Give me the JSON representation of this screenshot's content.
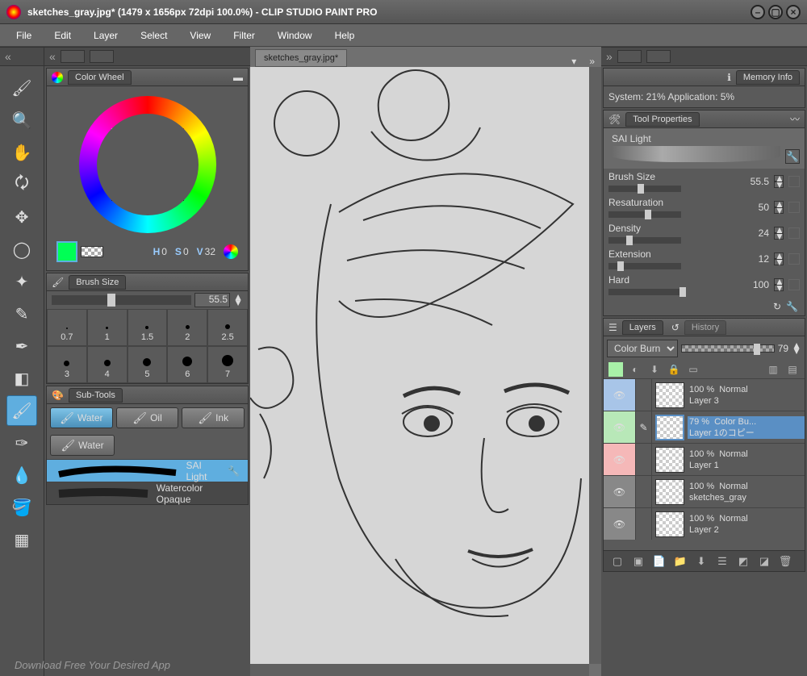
{
  "titlebar": {
    "text": "sketches_gray.jpg* (1479 x 1656px 72dpi 100.0%)  - CLIP STUDIO PAINT PRO"
  },
  "menu": [
    "File",
    "Edit",
    "Layer",
    "Select",
    "View",
    "Filter",
    "Window",
    "Help"
  ],
  "tools": [
    {
      "n": "brush-tool",
      "g": "🖌"
    },
    {
      "n": "zoom-tool",
      "g": "🔍"
    },
    {
      "n": "hand-tool",
      "g": "✋"
    },
    {
      "n": "rotate-tool",
      "g": "🗘"
    },
    {
      "n": "move-tool",
      "g": "✥"
    },
    {
      "n": "lasso-tool",
      "g": "◯"
    },
    {
      "n": "wand-tool",
      "g": "✦"
    },
    {
      "n": "eyedropper-tool",
      "g": "✎"
    },
    {
      "n": "pen-tool",
      "g": "✒"
    },
    {
      "n": "eraser-tool",
      "g": "◧"
    },
    {
      "n": "watercolor-tool",
      "g": "🖌",
      "sel": true
    },
    {
      "n": "airbrush-tool",
      "g": "✑"
    },
    {
      "n": "blur-tool",
      "g": "💧"
    },
    {
      "n": "fill-tool",
      "g": "🪣"
    },
    {
      "n": "gradient-tool",
      "g": "▦"
    }
  ],
  "color": {
    "title": "Color Wheel",
    "swatch": "#00ff55",
    "hsv_h": "0",
    "hsv_s": "0",
    "hsv_v": "32"
  },
  "brush": {
    "title": "Brush Size",
    "value": "55.5",
    "presets": [
      "0.7",
      "1",
      "1.5",
      "2",
      "2.5",
      "3",
      "4",
      "5",
      "6",
      "7"
    ]
  },
  "subtools": {
    "title": "Sub-Tools",
    "cats": [
      "Water",
      "Oil",
      "Ink"
    ],
    "row2": "Water",
    "list": [
      "SAI Light",
      "Watercolor Opaque"
    ]
  },
  "canvas": {
    "tab": "sketches_gray.jpg*"
  },
  "memory": {
    "title": "Memory Info",
    "text": "System: 21%   Application:  5%"
  },
  "props": {
    "title": "Tool Properties",
    "name": "SAI Light",
    "rows": [
      {
        "l": "Brush Size",
        "v": "55.5",
        "p": "40%"
      },
      {
        "l": "Resaturation",
        "v": "50",
        "p": "50%"
      },
      {
        "l": "Density",
        "v": "24",
        "p": "24%"
      },
      {
        "l": "Extension",
        "v": "12",
        "p": "12%"
      },
      {
        "l": "Hard",
        "v": "100",
        "p": "98%"
      }
    ]
  },
  "layers": {
    "title": "Layers",
    "tab2": "History",
    "blend": "Color Burn",
    "opacity": "79",
    "swatch": "#a8f0a8",
    "items": [
      {
        "c": "c-blue",
        "op": "100 %",
        "mode": "Normal",
        "name": "Layer 3"
      },
      {
        "c": "c-green",
        "op": "79 %",
        "mode": "Color Bu...",
        "name": "Layer 1のコピー",
        "sel": true,
        "edit": true
      },
      {
        "c": "c-pink",
        "op": "100 %",
        "mode": "Normal",
        "name": "Layer 1"
      },
      {
        "c": "c-gray",
        "op": "100 %",
        "mode": "Normal",
        "name": "sketches_gray"
      },
      {
        "c": "c-gray",
        "op": "100 %",
        "mode": "Normal",
        "name": "Layer 2"
      }
    ]
  },
  "watermark": "Download Free Your Desired App"
}
